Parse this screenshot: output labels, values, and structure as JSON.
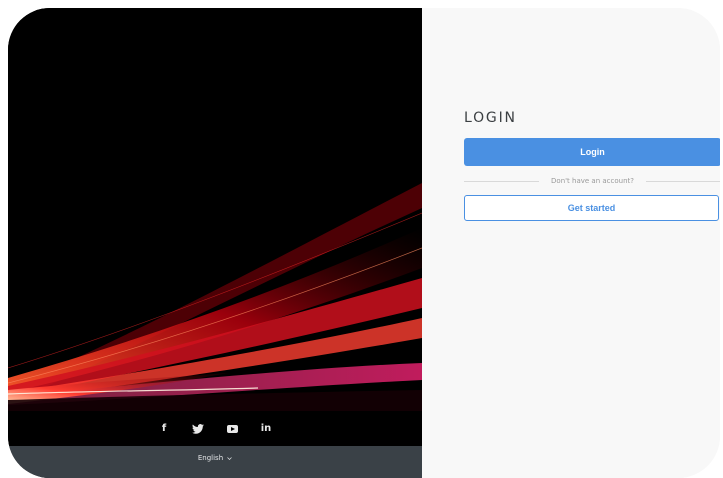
{
  "social": {
    "facebook": "f",
    "twitter": "twitter-bird-icon",
    "youtube": "youtube-icon",
    "linkedin": "in"
  },
  "language": {
    "selected": "English"
  },
  "login": {
    "title": "LOGIN",
    "login_button": "Login",
    "divider_text": "Don't have an account?",
    "get_started_button": "Get started"
  },
  "colors": {
    "accent": "#4a90e2",
    "language_bar": "#3a4147",
    "panel_background": "#f8f8f8"
  }
}
